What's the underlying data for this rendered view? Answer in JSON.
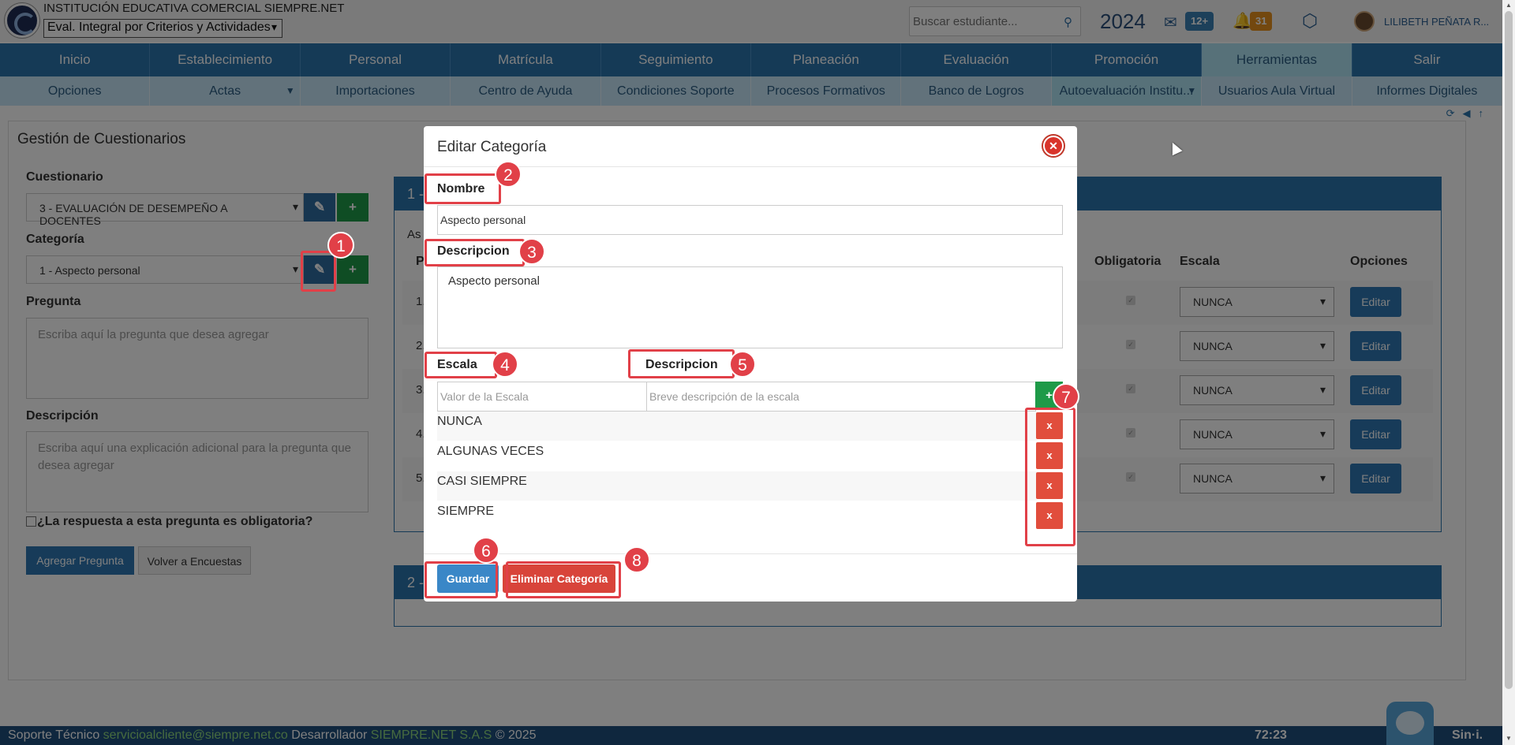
{
  "header": {
    "institution": "INSTITUCIÓN EDUCATIVA COMERCIAL SIEMPRE.NET",
    "mode_select": "Eval. Integral por Criterios y Actividades",
    "search_placeholder": "Buscar estudiante...",
    "year": "2024",
    "messages_badge": "12+",
    "notifications_badge": "31",
    "user_name": "LILIBETH PEÑATA R...",
    "icons": [
      "search-icon",
      "mail-icon",
      "bell-icon",
      "cube-icon"
    ]
  },
  "nav_main": [
    "Inicio",
    "Establecimiento",
    "Personal",
    "Matrícula",
    "Seguimiento",
    "Planeación",
    "Evaluación",
    "Promoción",
    "Herramientas",
    "Salir"
  ],
  "nav_main_active": "Herramientas",
  "nav_sub": [
    "Opciones",
    "Actas",
    "Importaciones",
    "Centro de Ayuda",
    "Condiciones Soporte",
    "Procesos Formativos",
    "Banco de Logros",
    "Autoevaluación Institu...",
    "Usuarios Aula Virtual",
    "Informes Digitales"
  ],
  "page": {
    "title": "Gestión de Cuestionarios",
    "cuestionario_label": "Cuestionario",
    "cuestionario_value": "3 - EVALUACIÓN DE DESEMPEÑO A DOCENTES",
    "categoria_label": "Categoría",
    "categoria_value": "1 - Aspecto personal",
    "pregunta_label": "Pregunta",
    "pregunta_placeholder": "Escriba aquí la pregunta que desea agregar",
    "descripcion_label": "Descripción",
    "descripcion_placeholder": "Escriba aquí una explicación adicional para la pregunta que desea agregar",
    "obligatoria_label": "¿La respuesta a esta pregunta es obligatoria?",
    "add_button": "Agregar Pregunta",
    "back_button": "Volver a Encuestas",
    "card1_head": "1 -",
    "card1_stub": "As",
    "card2_head": "2 -",
    "table_headers": [
      "P",
      "Obligatoria",
      "Escala",
      "Opciones"
    ],
    "rows": [
      {
        "num": "1.",
        "scale": "NUNCA",
        "action": "Editar"
      },
      {
        "num": "2.",
        "scale": "NUNCA",
        "action": "Editar"
      },
      {
        "num": "3.",
        "scale": "NUNCA",
        "action": "Editar"
      },
      {
        "num": "4.",
        "scale": "NUNCA",
        "action": "Editar"
      },
      {
        "num": "5.",
        "scale": "NUNCA",
        "action": "Editar"
      }
    ]
  },
  "modal": {
    "title": "Editar Categoría",
    "nombre_label": "Nombre",
    "nombre_value": "Aspecto personal",
    "descripcion_label": "Descripcion",
    "descripcion_value": "Aspecto personal",
    "escala_label": "Escala",
    "escala_desc_label": "Descripcion",
    "escala_placeholder": "Valor de la Escala",
    "escala_desc_placeholder": "Breve descripción de la escala",
    "add_label": "+",
    "delete_label": "x",
    "scales": [
      "NUNCA",
      "ALGUNAS VECES",
      "CASI SIEMPRE",
      "SIEMPRE"
    ],
    "save_button": "Guardar",
    "delete_button": "Eliminar Categoría"
  },
  "annotations": [
    "1",
    "2",
    "3",
    "4",
    "5",
    "6",
    "7",
    "8"
  ],
  "footer": {
    "support_label": "Soporte Técnico",
    "support_email": "servicioalcliente@siempre.net.co",
    "dev_label": "Desarrollador",
    "dev_name": "SIEMPRE.NET S.A.S",
    "copyright": "© 2025",
    "clock": "72:23",
    "brand": "Sin·i."
  },
  "colors": {
    "primary": "#2b74ad",
    "success": "#1e9a48",
    "danger": "#e14d3c",
    "annotation": "#e14048"
  }
}
